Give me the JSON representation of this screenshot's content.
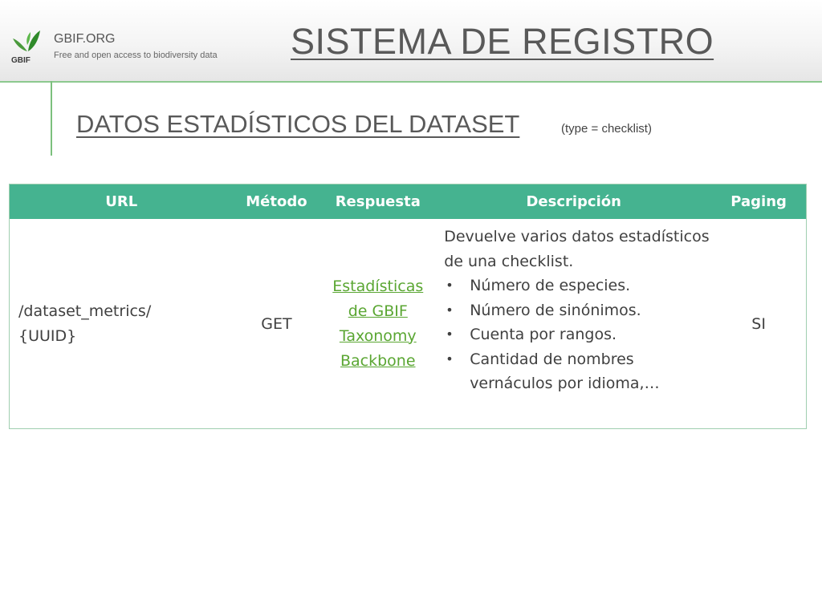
{
  "header": {
    "logo_icon": "gbif-leaf-logo",
    "logo_icon_text": "GBIF",
    "logo_name": "GBIF.ORG",
    "logo_tagline": "Free and open access to biodiversity data",
    "title": " SISTEMA DE REGISTRO ",
    "accent_color": "#7cc07d"
  },
  "section": {
    "subtitle": "DATOS ESTADÍSTICOS DEL DATASET ",
    "note": "(type = checklist)"
  },
  "table": {
    "header_color": "#45b390",
    "columns": [
      "URL",
      "Método",
      "Respuesta",
      "Descripción",
      "Paging"
    ],
    "row": {
      "url_line1": "/dataset_metrics/",
      "url_line2": "{UUID}",
      "method": "GET",
      "response_link": [
        "Estadísticas",
        "de GBIF",
        "Taxonomy",
        "Backbone"
      ],
      "description_intro": "Devuelve varios datos estadísticos de una checklist.",
      "description_items": [
        "Número de especies.",
        "Número de sinónimos.",
        "Cuenta por rangos.",
        "Cantidad de nombres vernáculos por idioma,…"
      ],
      "paging": "SI"
    }
  }
}
